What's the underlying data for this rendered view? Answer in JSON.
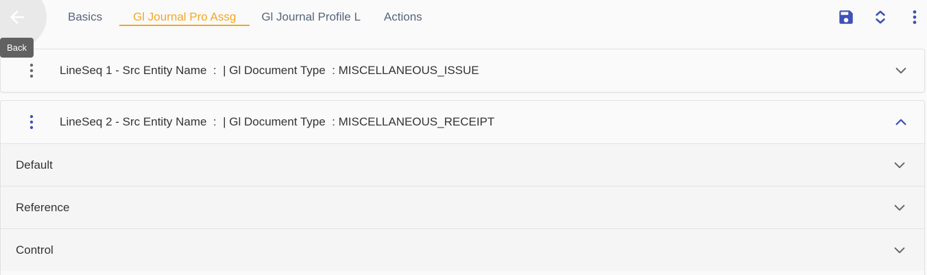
{
  "header": {
    "back_tooltip": "Back",
    "back_icon": "arrow-left-icon",
    "tabs": [
      {
        "label": "Basics",
        "active": false
      },
      {
        "label": "Gl Journal Pro Assg",
        "active": true
      },
      {
        "label": "Gl Journal Profile L",
        "active": false
      },
      {
        "label": "Actions",
        "active": false
      }
    ],
    "toolbar_icons": [
      "save-icon",
      "expand-collapse-icon",
      "more-vert-icon"
    ]
  },
  "colors": {
    "accent": "#f5a623",
    "primary": "#3f51b5",
    "tab_text": "#55657a",
    "icon_gray": "#666666"
  },
  "lines": [
    {
      "title": "LineSeq 1 - Src Entity Name  :  | Gl Document Type  : MISCELLANEOUS_ISSUE",
      "expanded": false
    },
    {
      "title": "LineSeq 2 - Src Entity Name  :  | Gl Document Type  : MISCELLANEOUS_RECEIPT",
      "expanded": true,
      "sections": [
        {
          "label": "Default"
        },
        {
          "label": "Reference"
        },
        {
          "label": "Control"
        }
      ]
    }
  ]
}
